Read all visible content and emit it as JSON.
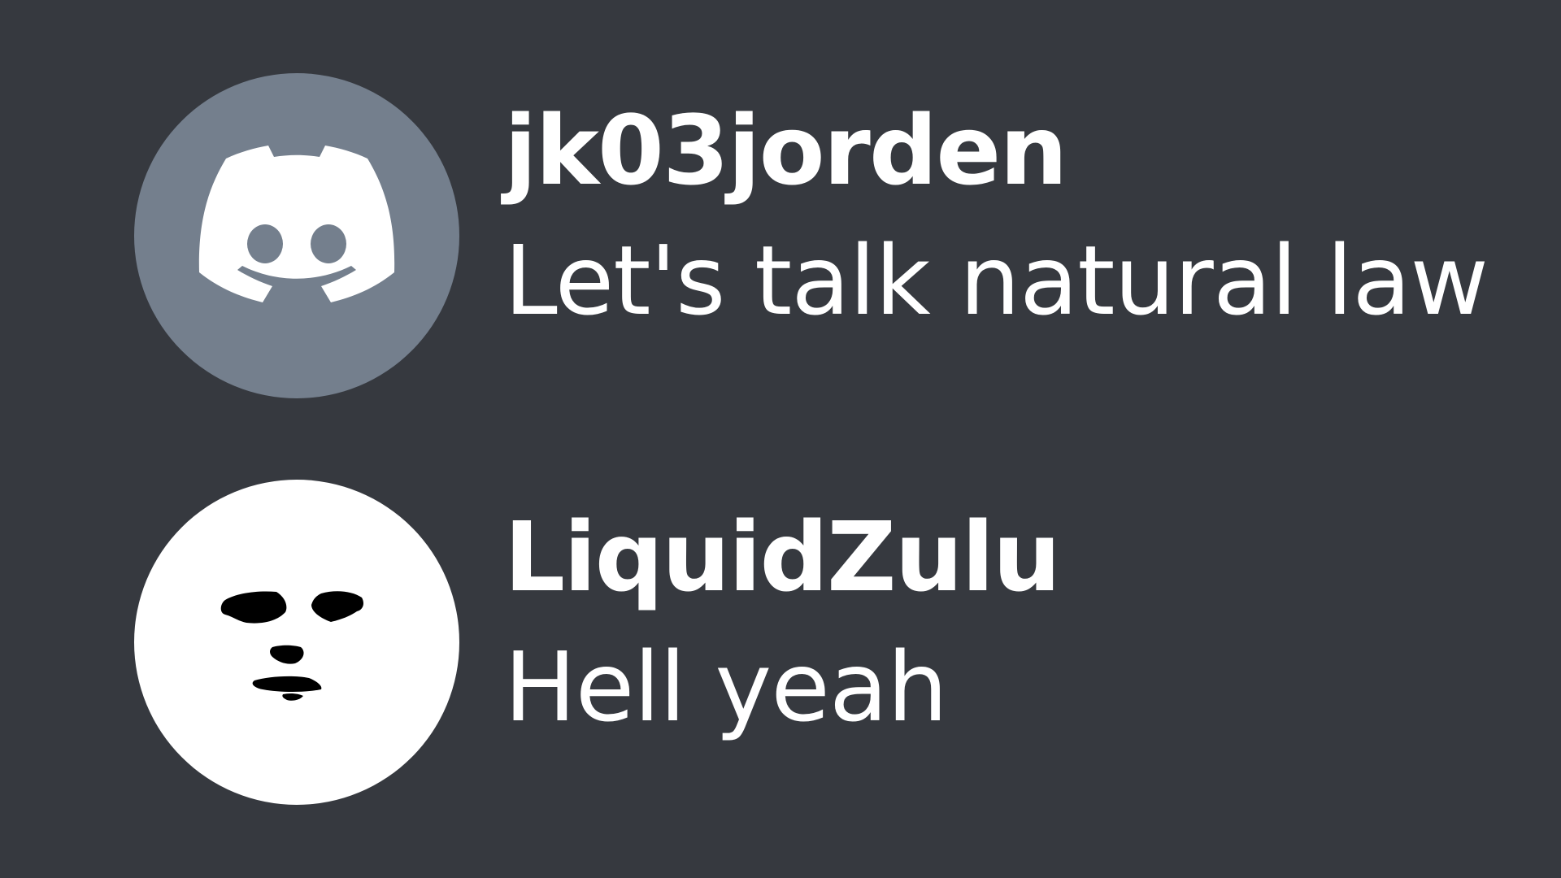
{
  "messages": [
    {
      "username": "jk03jorden",
      "text": "Let's talk natural law",
      "avatar": {
        "icon": "discord-logo-icon",
        "background": "#747f8d"
      }
    },
    {
      "username": "LiquidZulu",
      "text": "Hell yeah",
      "avatar": {
        "icon": "face-icon",
        "background": "#ffffff"
      }
    }
  ],
  "colors": {
    "background": "#36393f",
    "text": "#ffffff"
  }
}
